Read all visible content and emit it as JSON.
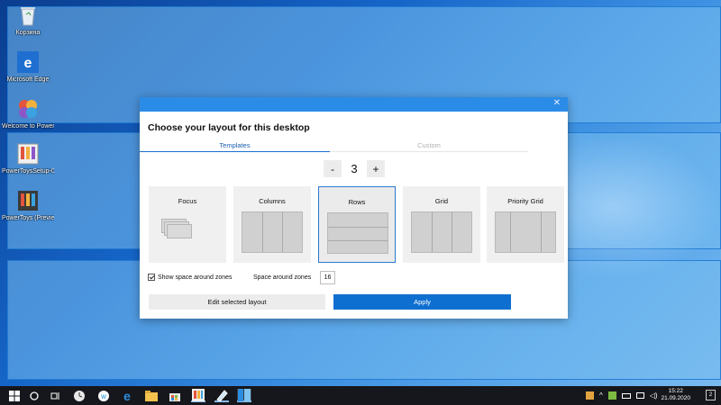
{
  "desktop": {
    "icons": [
      {
        "label": "Корзина",
        "icon": "recycle-bin-icon"
      },
      {
        "label": "Microsoft Edge",
        "icon": "edge-icon"
      },
      {
        "label": "Welcome to PowerToys",
        "icon": "powertoys-welcome-icon"
      },
      {
        "label": "PowerToysSetup-0.2...",
        "icon": "powertoys-setup-icon"
      },
      {
        "label": "PowerToys (Preview)",
        "icon": "powertoys-icon"
      }
    ]
  },
  "dialog": {
    "title": "Choose your layout for this desktop",
    "tabs": [
      {
        "label": "Templates",
        "active": true
      },
      {
        "label": "Custom",
        "active": false
      }
    ],
    "stepper": {
      "minus": "-",
      "value": "3",
      "plus": "+"
    },
    "layouts": [
      {
        "name": "Focus",
        "selected": false
      },
      {
        "name": "Columns",
        "selected": false
      },
      {
        "name": "Rows",
        "selected": true
      },
      {
        "name": "Grid",
        "selected": false
      },
      {
        "name": "Priority Grid",
        "selected": false
      }
    ],
    "show_space_label": "Show space around zones",
    "show_space_checked": true,
    "space_label": "Space around zones",
    "space_value": "16",
    "edit_button": "Edit selected layout",
    "apply_button": "Apply",
    "close_glyph": "✕"
  },
  "taskbar": {
    "clock_time": "15:22",
    "clock_date": "21.09.2020",
    "notification_count": "2",
    "accent": "#0f6fd1"
  }
}
